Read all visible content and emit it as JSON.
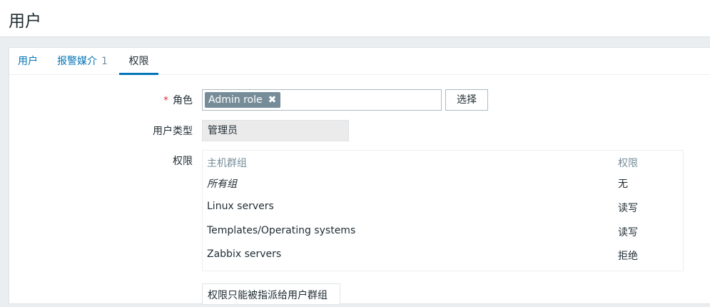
{
  "page": {
    "title": "用户"
  },
  "tabs": [
    {
      "label": "用户"
    },
    {
      "label": "报警媒介",
      "count": "1"
    },
    {
      "label": "权限"
    }
  ],
  "form": {
    "role_label": "角色",
    "required_mark": "*",
    "role_chip": "Admin role",
    "role_chip_remove": "✖",
    "select_button": "选择",
    "user_type_label": "用户类型",
    "user_type_value": "管理员",
    "permissions_label": "权限",
    "permissions_table": {
      "headers": [
        "主机群组",
        "权限"
      ],
      "rows": [
        {
          "group": "所有组",
          "permission": "无"
        },
        {
          "group": "Linux servers",
          "permission": "读写"
        },
        {
          "group": "Templates/Operating systems",
          "permission": "读写"
        },
        {
          "group": "Zabbix servers",
          "permission": "拒绝"
        }
      ]
    },
    "note": "权限只能被指派给用户群组"
  }
}
